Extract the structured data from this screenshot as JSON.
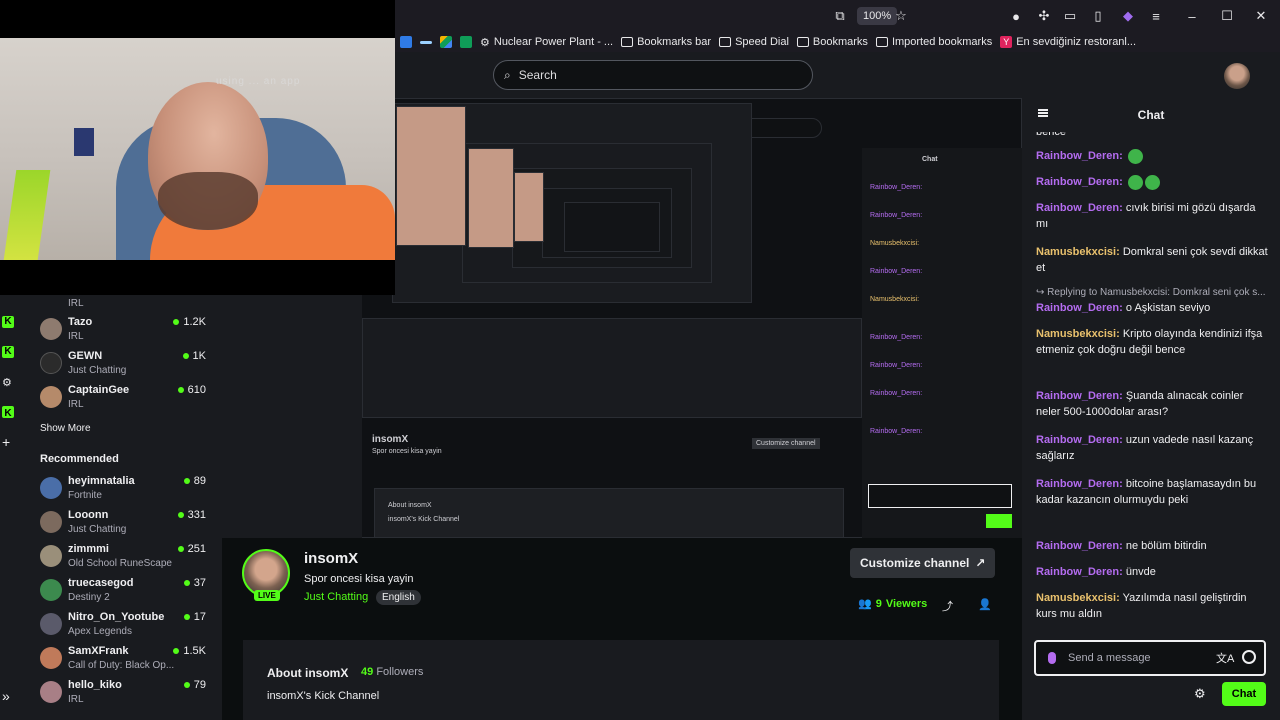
{
  "browser": {
    "zoom": "100%",
    "bookmarks": [
      {
        "label": "Nuclear Power Plant - ...",
        "icon": "gear-icon"
      },
      {
        "label": "Bookmarks bar",
        "icon": "folder-icon"
      },
      {
        "label": "Speed Dial",
        "icon": "folder-icon"
      },
      {
        "label": "Bookmarks",
        "icon": "folder-icon"
      },
      {
        "label": "Imported bookmarks",
        "icon": "folder-icon"
      },
      {
        "label": "En sevdiğiniz restoranl...",
        "icon": "y-icon"
      }
    ],
    "colors": {
      "chrome": "#1c1b22"
    }
  },
  "header": {
    "search_placeholder": "Search"
  },
  "webcam": {
    "overlay_text": "using ... an app"
  },
  "sidebar": {
    "partial_top_category": "IRL",
    "following": [
      {
        "name": "Tazo",
        "category": "IRL",
        "viewers": "1.2K"
      },
      {
        "name": "GEWN",
        "category": "Just Chatting",
        "viewers": "1K"
      },
      {
        "name": "CaptainGee",
        "category": "IRL",
        "viewers": "610"
      }
    ],
    "show_more": "Show More",
    "recommended_title": "Recommended",
    "recommended": [
      {
        "name": "heyimnatalia",
        "category": "Fortnite",
        "viewers": "89"
      },
      {
        "name": "Looonn",
        "category": "Just Chatting",
        "viewers": "331"
      },
      {
        "name": "zimmmi",
        "category": "Old School RuneScape",
        "viewers": "251"
      },
      {
        "name": "truecasegod",
        "category": "Destiny 2",
        "viewers": "37"
      },
      {
        "name": "Nitro_On_Yootube",
        "category": "Apex Legends",
        "viewers": "17"
      },
      {
        "name": "SamXFrank",
        "category": "Call of Duty: Black Op...",
        "viewers": "1.5K"
      },
      {
        "name": "hello_kiko",
        "category": "IRL",
        "viewers": "79"
      }
    ],
    "collapse_icon": "»",
    "accent": "#53fc18"
  },
  "stream": {
    "live_label": "LIVE",
    "streamer": "insomX",
    "title": "Spor oncesi kisa yayin",
    "category": "Just Chatting",
    "language": "English",
    "customize_label": "Customize channel",
    "viewers_count": "9",
    "viewers_label": "Viewers",
    "about_title": "About insomX",
    "followers_count": "49",
    "followers_label": "Followers",
    "about_desc": "insomX's Kick Channel"
  },
  "chat": {
    "title": "Chat",
    "partial_top": "bence",
    "messages": [
      {
        "user": "Rainbow_Deren",
        "text": "",
        "emotes": 1,
        "color": "#b46cf0"
      },
      {
        "user": "Rainbow_Deren",
        "text": "",
        "emotes": 2,
        "color": "#b46cf0"
      },
      {
        "user": "Rainbow_Deren",
        "text": "cıvık birisi mi gözü dışarda mı",
        "emotes": 0,
        "color": "#b46cf0"
      },
      {
        "user": "Namusbekxcisi",
        "text": "Domkral seni çok sevdi dikkat et",
        "emotes": 0,
        "color": "#e9c16d"
      },
      {
        "user": "Rainbow_Deren",
        "text": "o Aşkistan seviyo",
        "emotes": 0,
        "color": "#b46cf0",
        "reply": "Replying to Namusbekxcisi: Domkral seni çok s..."
      },
      {
        "user": "Namusbekxcisi",
        "text": "Kripto olayında kendinizi ifşa etmeniz çok doğru değil bence",
        "emotes": 0,
        "color": "#e9c16d"
      },
      {
        "user": "Rainbow_Deren",
        "text": "Şuanda alınacak coinler neler 500-1000dolar arası?",
        "emotes": 0,
        "color": "#b46cf0"
      },
      {
        "user": "Rainbow_Deren",
        "text": "uzun vadede nasıl kazanç sağlarız",
        "emotes": 0,
        "color": "#b46cf0"
      },
      {
        "user": "Rainbow_Deren",
        "text": "bitcoine başlamasaydın bu kadar kazancın olurmuydu peki",
        "emotes": 0,
        "color": "#b46cf0"
      },
      {
        "user": "Rainbow_Deren",
        "text": "ne bölüm bitirdin",
        "emotes": 0,
        "color": "#b46cf0"
      },
      {
        "user": "Rainbow_Deren",
        "text": "ünvde",
        "emotes": 0,
        "color": "#b46cf0"
      },
      {
        "user": "Namusbekxcisi",
        "text": "Yazılımda nasıl geliştirdin kurs mu aldın",
        "emotes": 0,
        "color": "#e9c16d"
      }
    ],
    "input_placeholder": "Send a message",
    "send_label": "Chat"
  }
}
